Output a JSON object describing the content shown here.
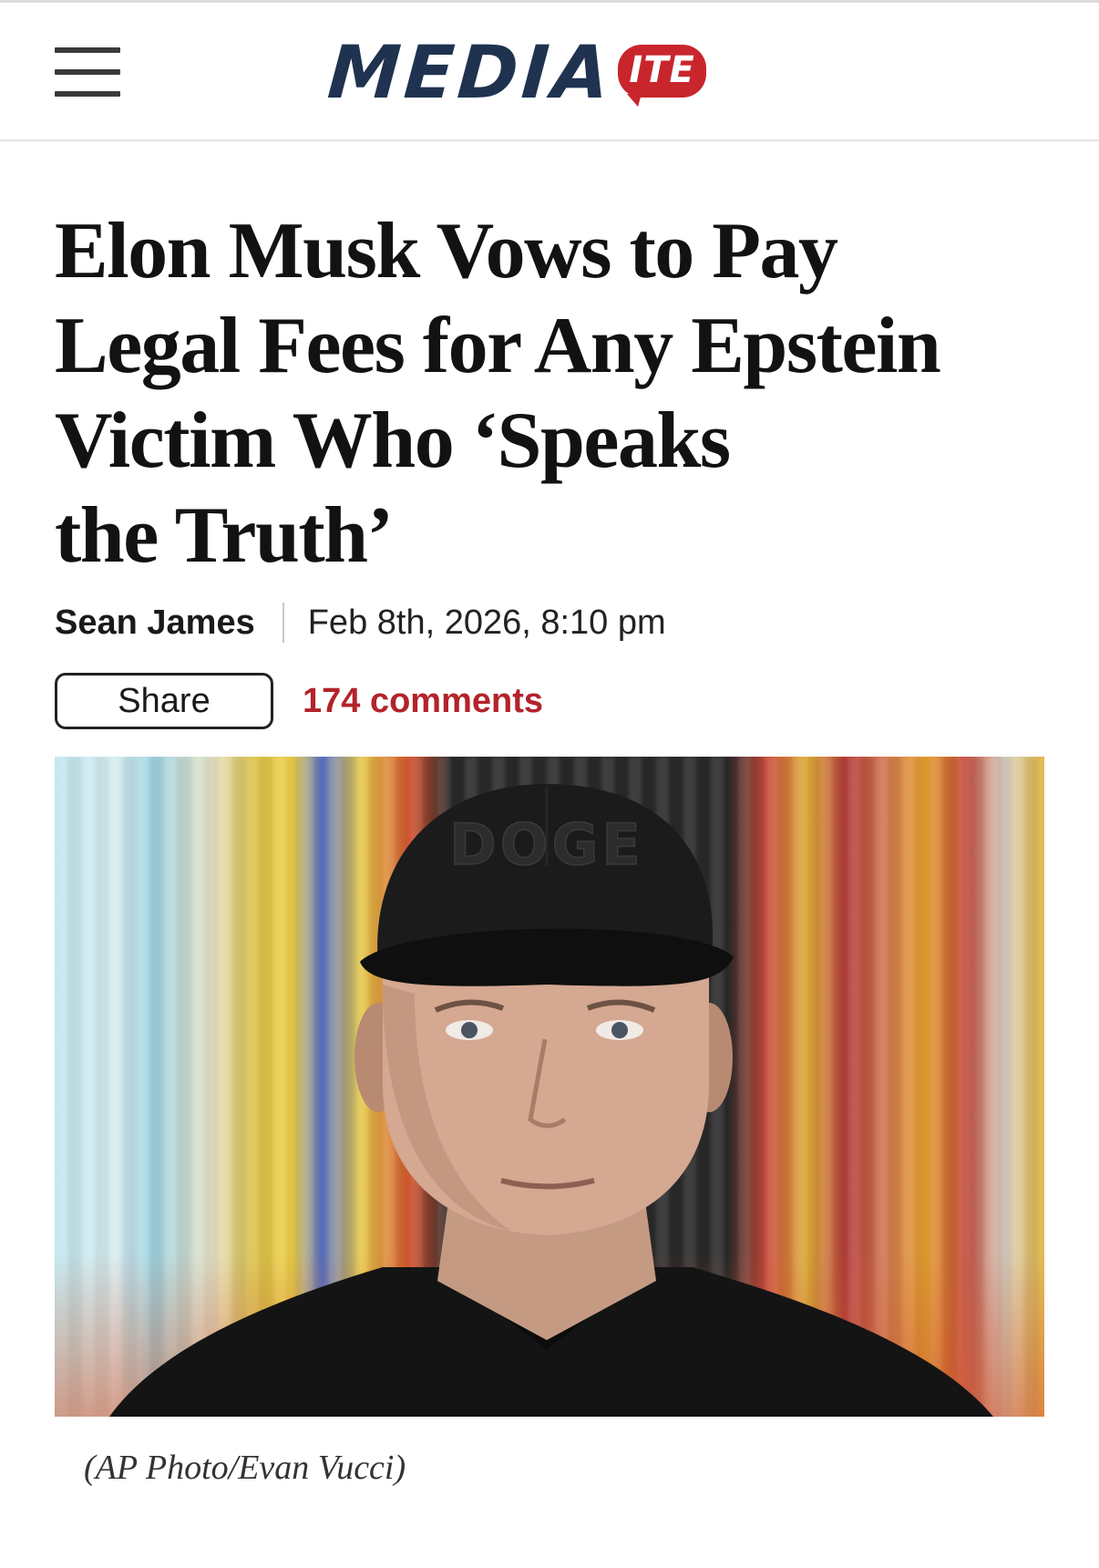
{
  "header": {
    "logo_word": "MEDIA",
    "logo_badge": "ITE",
    "brand_color": "#c8262c",
    "logo_color": "#1f3350",
    "menu_icon": "hamburger-menu-icon"
  },
  "article": {
    "headline_lines": [
      "Elon Musk Vows to Pay",
      "Legal Fees for Any Epstein",
      "Victim Who ‘Speaks",
      "the Truth’"
    ],
    "author": "Sean James",
    "date": "Feb 8th, 2026, 8:10 pm",
    "share_label": "Share",
    "comments_label": "174 comments",
    "comments_color": "#b3232a",
    "photo": {
      "cap_text": "DOGE"
    },
    "caption": "(AP Photo/Evan Vucci)"
  }
}
